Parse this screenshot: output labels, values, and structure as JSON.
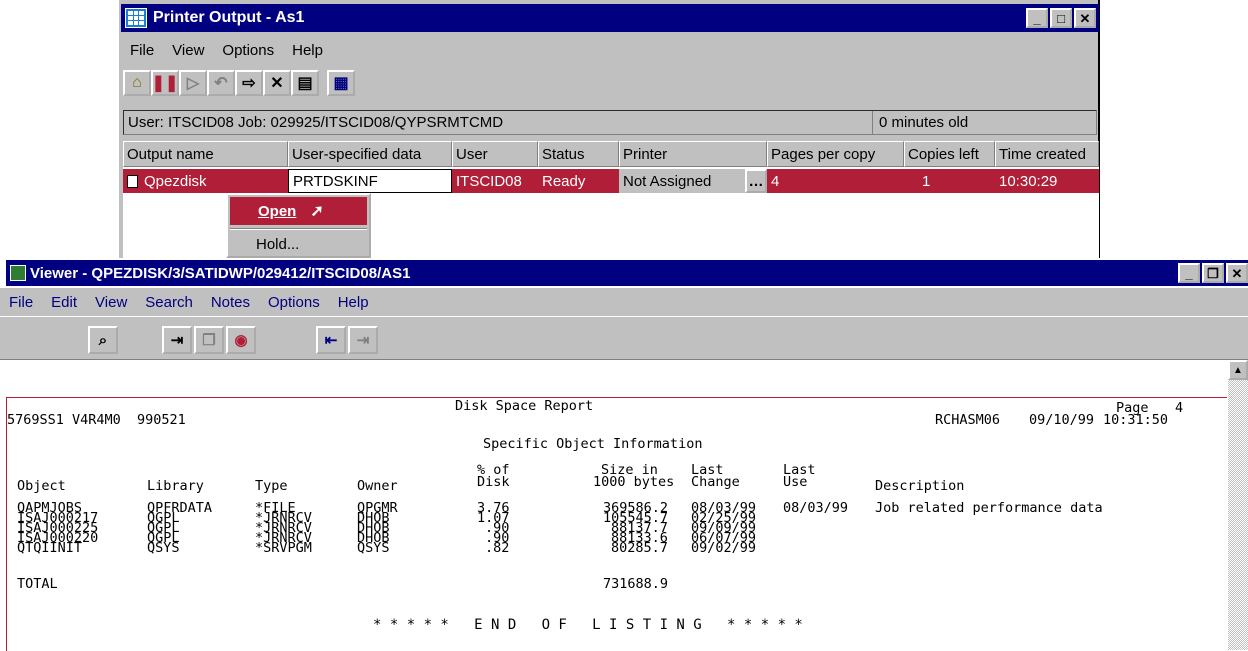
{
  "printer_window": {
    "title": "Printer Output - As1",
    "menu": [
      "File",
      "View",
      "Options",
      "Help"
    ],
    "toolbar_icons": [
      "open-folder-icon",
      "hold-icon",
      "release-icon",
      "reply-icon",
      "move-icon",
      "delete-icon",
      "properties-icon",
      "columns-icon"
    ],
    "info_user": "User: ITSCID08   Job: 029925/ITSCID08/QYPSRMTCMD",
    "info_age": "0 minutes old",
    "columns": [
      "Output name",
      "User-specified data",
      "User",
      "Status",
      "Printer",
      "Pages per copy",
      "Copies left",
      "Time created"
    ],
    "row": {
      "output_name": "Qpezdisk",
      "user_data": "PRTDSKINF",
      "user": "ITSCID08",
      "status": "Ready",
      "printer": "Not Assigned",
      "pages": "4",
      "copies": "1",
      "time": "10:30:29"
    },
    "context_menu": {
      "open": "Open",
      "hold": "Hold..."
    }
  },
  "viewer_window": {
    "title": "Viewer - QPEZDISK/3/SATIDWP/029412/ITSCID08/AS1",
    "menu": [
      "File",
      "Edit",
      "View",
      "Search",
      "Notes",
      "Options",
      "Help"
    ]
  },
  "report": {
    "left_header": "5769SS1 V4R4M0  990521",
    "title": "Disk Space Report",
    "system": "RCHASM06",
    "date": "09/10/99",
    "time": "10:31:50",
    "page_label": "Page",
    "page_num": "4",
    "subtitle": "Specific Object Information",
    "headers": {
      "object": "Object",
      "library": "Library",
      "type": "Type",
      "owner": "Owner",
      "pct_top": "% of",
      "pct_bot": "Disk",
      "size_top": "Size in",
      "size_bot": "1000 bytes",
      "change_top": "Last",
      "change_bot": "Change",
      "use_top": "Last",
      "use_bot": "Use",
      "description": "Description"
    },
    "rows": [
      {
        "object": "QAPMJOBS",
        "library": "QPFRDATA",
        "type": "*FILE",
        "owner": "QPGMR",
        "pct": "3.76",
        "size": "369586.2",
        "change": "08/03/99",
        "use": "08/03/99",
        "desc": "Job related performance data"
      },
      {
        "object": "ISAJ000217",
        "library": "QGPL",
        "type": "*JRNRCV",
        "owner": "DHOB",
        "pct": "1.07",
        "size": "105545.7",
        "change": "02/25/99",
        "use": "",
        "desc": ""
      },
      {
        "object": "ISAJ000225",
        "library": "QGPL",
        "type": "*JRNRCV",
        "owner": "DHOB",
        "pct": ".90",
        "size": "88137.7",
        "change": "09/09/99",
        "use": "",
        "desc": ""
      },
      {
        "object": "ISAJ000220",
        "library": "QGPL",
        "type": "*JRNRCV",
        "owner": "DHOB",
        "pct": ".90",
        "size": "88133.6",
        "change": "06/07/99",
        "use": "",
        "desc": ""
      },
      {
        "object": "QTQIINIT",
        "library": "QSYS",
        "type": "*SRVPGM",
        "owner": "QSYS",
        "pct": ".82",
        "size": "80285.7",
        "change": "09/02/99",
        "use": "",
        "desc": ""
      }
    ],
    "total_label": "TOTAL",
    "total_value": "731688.9",
    "end_text": "* * * * *   E N D   O F   L I S T I N G   * * * * *"
  }
}
